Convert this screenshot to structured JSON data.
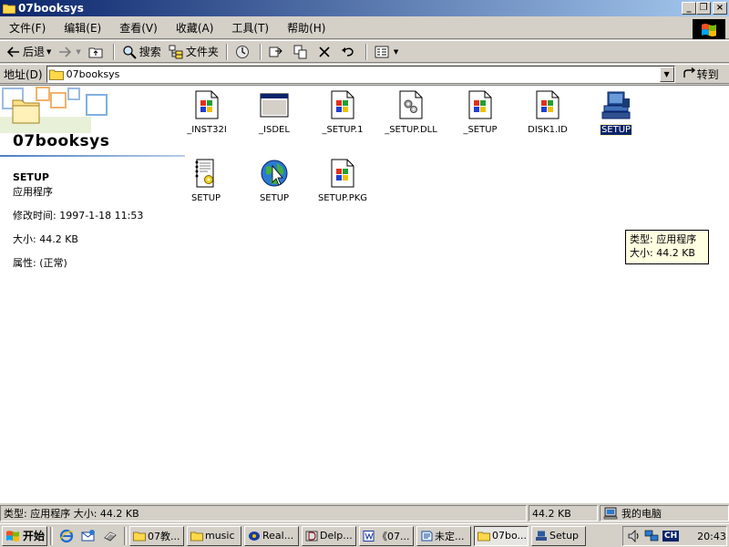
{
  "window": {
    "title": "07booksys",
    "btn_min": "_",
    "btn_max": "❐",
    "btn_close": "×"
  },
  "menu": [
    {
      "label": "文件(F)"
    },
    {
      "label": "编辑(E)"
    },
    {
      "label": "查看(V)"
    },
    {
      "label": "收藏(A)"
    },
    {
      "label": "工具(T)"
    },
    {
      "label": "帮助(H)"
    }
  ],
  "toolbar": {
    "back": "后退",
    "search": "搜索",
    "folders": "文件夹"
  },
  "address": {
    "label": "地址(D)",
    "value": "07booksys",
    "go": "转到"
  },
  "left_pane": {
    "folder_title": "07booksys",
    "selected_name": "SETUP",
    "selected_type": "应用程序",
    "modified": "修改时间: 1997-1-18 11:53",
    "size": "大小: 44.2 KB",
    "attributes": "属性: (正常)"
  },
  "files": [
    {
      "name": "_INST32I",
      "icon": "windows-file-icon"
    },
    {
      "name": "_ISDEL",
      "icon": "window-app-icon"
    },
    {
      "name": "_SETUP.1",
      "icon": "windows-file-icon"
    },
    {
      "name": "_SETUP.DLL",
      "icon": "dll-gear-icon"
    },
    {
      "name": "_SETUP",
      "icon": "windows-file-icon"
    },
    {
      "name": "DISK1.ID",
      "icon": "windows-file-icon"
    },
    {
      "name": "SETUP",
      "icon": "setup-computer-icon",
      "selected": true
    },
    {
      "name": "SETUP",
      "icon": "settings-file-icon"
    },
    {
      "name": "SETUP",
      "icon": "globe-app-icon"
    },
    {
      "name": "SETUP.PKG",
      "icon": "windows-file-icon"
    }
  ],
  "tooltip": {
    "line1": "类型: 应用程序",
    "line2": "大小: 44.2 KB"
  },
  "status": {
    "main": "类型: 应用程序 大小: 44.2 KB",
    "size": "44.2 KB",
    "zone": "我的电脑"
  },
  "taskbar": {
    "start": "开始",
    "tasks": [
      {
        "label": "07教...",
        "icon": "folder-icon"
      },
      {
        "label": "music",
        "icon": "folder-icon"
      },
      {
        "label": "Real...",
        "icon": "realplayer-icon"
      },
      {
        "label": "Delp...",
        "icon": "delphi-icon"
      },
      {
        "label": "《07...",
        "icon": "word-icon"
      },
      {
        "label": "未定...",
        "icon": "notepad-icon"
      },
      {
        "label": "07bo...",
        "icon": "folder-icon",
        "active": true
      },
      {
        "label": "Setup",
        "icon": "setup-computer-icon"
      }
    ],
    "tray_lang": "CH",
    "clock": "20:43"
  },
  "colors": {
    "title_gradient_start": "#0a246a",
    "title_gradient_end": "#a6caf0",
    "selection": "#0a246a",
    "tooltip_bg": "#ffffe1",
    "chrome": "#d4d0c8"
  }
}
